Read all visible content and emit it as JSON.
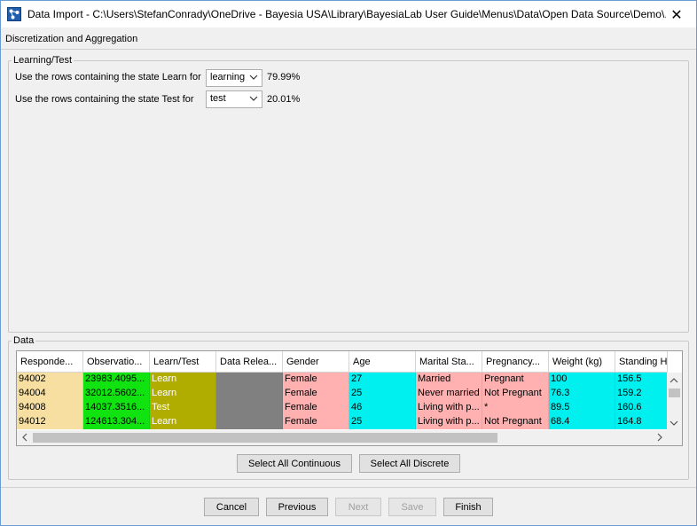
{
  "window": {
    "title": "Data Import - C:\\Users\\StefanConrady\\OneDrive - Bayesia USA\\Library\\BayesiaLab User Guide\\Menus\\Data\\Open Data Source\\Demo\\...",
    "close_label": "✕"
  },
  "step_title": "Discretization and Aggregation",
  "learning_test": {
    "legend": "Learning/Test",
    "learn_row": {
      "label": "Use the rows containing the state Learn for",
      "value": "learning",
      "percent": "79.99%"
    },
    "test_row": {
      "label": "Use the rows containing the state Test for",
      "value": "test",
      "percent": "20.01%"
    }
  },
  "data_section": {
    "legend": "Data",
    "columns": [
      {
        "header": "Responde...",
        "color": "#f6dfa0",
        "text_color": "#000000"
      },
      {
        "header": "Observatio...",
        "color": "#11e311",
        "text_color": "#000000"
      },
      {
        "header": "Learn/Test",
        "color": "#b1ad00",
        "text_color": "#ffffff"
      },
      {
        "header": "Data Relea...",
        "color": "#808080",
        "text_color": "#000000"
      },
      {
        "header": "Gender",
        "color": "#ffb0b0",
        "text_color": "#000000"
      },
      {
        "header": "Age",
        "color": "#00f0f0",
        "text_color": "#000000"
      },
      {
        "header": "Marital Sta...",
        "color": "#ffb0b0",
        "text_color": "#000000"
      },
      {
        "header": "Pregnancy...",
        "color": "#ffb0b0",
        "text_color": "#000000"
      },
      {
        "header": "Weight (kg)",
        "color": "#00f0f0",
        "text_color": "#000000"
      },
      {
        "header": "Standing H",
        "color": "#00f0f0",
        "text_color": "#000000"
      }
    ],
    "rows": [
      [
        "94002",
        "23983.4095...",
        "Learn",
        "",
        "Female",
        "27",
        "Married",
        "Pregnant",
        "100",
        "156.5"
      ],
      [
        "94004",
        "32012.5602...",
        "Learn",
        "",
        "Female",
        "25",
        "Never married",
        "Not Pregnant",
        "76.3",
        "159.2"
      ],
      [
        "94008",
        "14037.3516...",
        "Test",
        "",
        "Female",
        "46",
        "Living with p...",
        "*",
        "89.5",
        "160.6"
      ],
      [
        "94012",
        "124613.304...",
        "Learn",
        "",
        "Female",
        "25",
        "Living with p...",
        "Not Pregnant",
        "68.4",
        "164.8"
      ]
    ],
    "select_continuous_label": "Select All Continuous",
    "select_discrete_label": "Select All Discrete"
  },
  "footer": {
    "cancel": "Cancel",
    "previous": "Previous",
    "next": "Next",
    "save": "Save",
    "finish": "Finish"
  }
}
